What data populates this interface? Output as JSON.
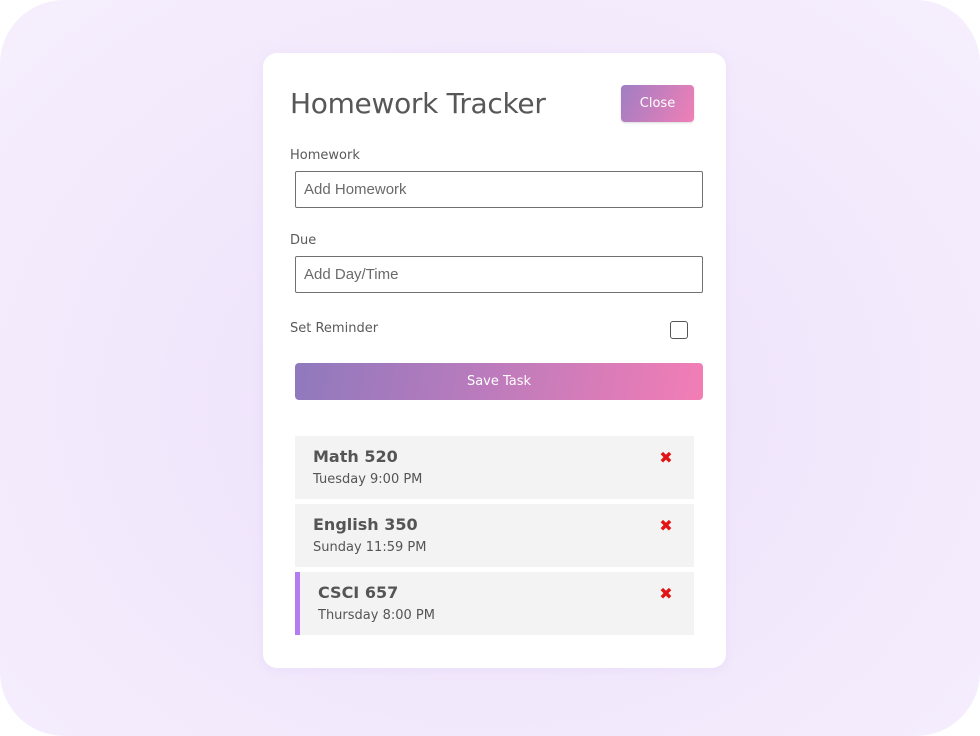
{
  "app": {
    "title": "Homework Tracker",
    "close_label": "Close"
  },
  "form": {
    "homework": {
      "label": "Homework",
      "placeholder": "Add Homework",
      "value": ""
    },
    "due": {
      "label": "Due",
      "placeholder": "Add Day/Time",
      "value": ""
    },
    "reminder": {
      "label": "Set Reminder",
      "checked": false
    },
    "save_label": "Save Task"
  },
  "tasks": [
    {
      "name": "Math 520",
      "due": "Tuesday 9:00 PM",
      "reminder": false,
      "delete_icon": "x-icon"
    },
    {
      "name": "English 350",
      "due": "Sunday 11:59 PM",
      "reminder": false,
      "delete_icon": "x-icon"
    },
    {
      "name": "CSCI 657",
      "due": "Thursday 8:00 PM",
      "reminder": true,
      "delete_icon": "x-icon"
    }
  ],
  "colors": {
    "accent_gradient_start": "#8f79bd",
    "accent_gradient_end": "#f37db5",
    "reminder_border": "#b57bf0",
    "delete": "#e31414",
    "task_bg": "#f3f3f3"
  }
}
